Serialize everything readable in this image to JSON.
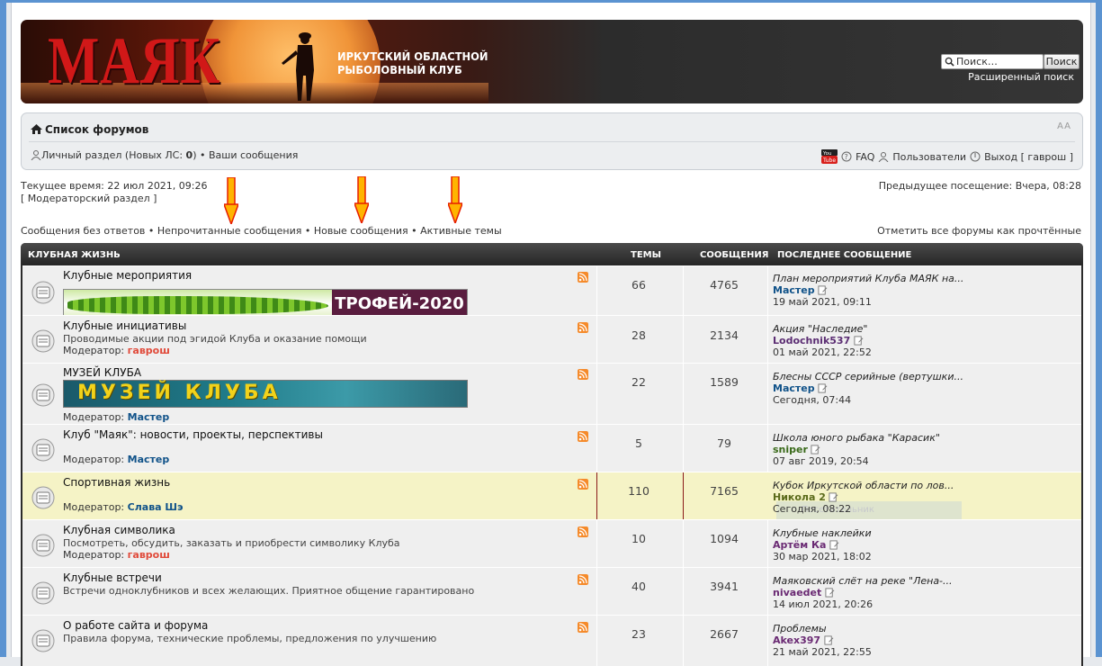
{
  "header": {
    "logo_text": "МАЯК",
    "subtitle_line1": "ИРКУТСКИЙ ОБЛАСТНОЙ",
    "subtitle_line2": "РЫБОЛОВНЫЙ КЛУБ",
    "search_placeholder": "Поиск…",
    "search_button": "Поиск",
    "advanced_search": "Расширенный поиск"
  },
  "navbar": {
    "breadcrumb": "Список форумов",
    "font_size_control": "A A",
    "personal": "Личный раздел (Новых ЛС: ",
    "personal_count": "0",
    "personal_end": ")",
    "your_posts": "Ваши сообщения",
    "faq": "FAQ",
    "users": "Пользователи",
    "logout": "Выход [ гаврош ]"
  },
  "info": {
    "current_time": "Текущее время: 22 июл 2021, 09:26",
    "mod_panel": "[ Модераторский раздел ]",
    "previous_visit": "Предыдущее посещение: Вчера, 08:28",
    "link_unanswered": "Сообщения без ответов",
    "link_unread": "Непрочитанные сообщения",
    "link_new": "Новые сообщения",
    "link_active": "Активные темы",
    "mark_read": "Отметить все форумы как прочтённые"
  },
  "colors": {
    "accent": "#105289",
    "highlight_row": "#f5f3c6",
    "arrow": "#ff2a00"
  },
  "forum": {
    "category": "КЛУБНАЯ ЖИЗНЬ",
    "col_topics": "ТЕМЫ",
    "col_posts": "СООБЩЕНИЯ",
    "col_last": "ПОСЛЕДНЕЕ СООБЩЕНИЕ",
    "mod_label": "Модератор:",
    "rows": [
      {
        "title": "Клубные мероприятия",
        "banner": "ТРОФЕЙ-2020",
        "topics": "66",
        "posts": "4765",
        "last_title": "План мероприятий Клуба МАЯК на...",
        "last_user": "Мастер",
        "last_time": "19 май 2021, 09:11"
      },
      {
        "title": "Клубные инициативы",
        "desc": "Проводимые акции под эгидой Клуба и оказание помощи",
        "moderator": "гаврош",
        "topics": "28",
        "posts": "2134",
        "last_title": "Акция \"Наследие\"",
        "last_user": "Lodochnik537",
        "last_time": "01 май 2021, 22:52"
      },
      {
        "title": "МУЗЕЙ КЛУБА",
        "banner": "МУЗЕЙ КЛУБА",
        "moderator": "Мастер",
        "topics": "22",
        "posts": "1589",
        "last_title": "Блесны СССР серийные (вертушки...",
        "last_user": "Мастер",
        "last_time": "Сегодня, 07:44"
      },
      {
        "title": "Клуб \"Маяк\": новости, проекты, перспективы",
        "moderator": "Мастер",
        "topics": "5",
        "posts": "79",
        "last_title": "Школа юного рыбака \"Карасик\"",
        "last_user": "sniper",
        "last_time": "07 авг 2019, 20:54"
      },
      {
        "title": "Спортивная жизнь",
        "moderator": "Слава Шэ",
        "topics": "110",
        "posts": "7165",
        "last_title": "Кубок Иркутской области по лов...",
        "last_user": "Никола 2",
        "last_time": "Сегодня, 08:22",
        "ghost": "Посетительник"
      },
      {
        "title": "Клубная символика",
        "desc": "Посмотреть, обсудить, заказать и приобрести символику Клуба",
        "moderator": "гаврош",
        "topics": "10",
        "posts": "1094",
        "last_title": "Клубные наклейки",
        "last_user": "Артём Ка",
        "last_time": "30 мар 2021, 18:02"
      },
      {
        "title": "Клубные встречи",
        "desc": "Встречи одноклубников и всех желающих. Приятное общение гарантировано",
        "topics": "40",
        "posts": "3941",
        "last_title": "Маяковский слёт на реке \"Лена-...",
        "last_user": "nivaedet",
        "last_time": "14 июл 2021, 20:26"
      },
      {
        "title": "О работе сайта и форума",
        "desc": "Правила форума, технические проблемы, предложения по улучшению",
        "topics": "23",
        "posts": "2667",
        "last_title": "Проблемы",
        "last_user": "Akex397",
        "last_time": "21 май 2021, 22:55"
      }
    ]
  }
}
